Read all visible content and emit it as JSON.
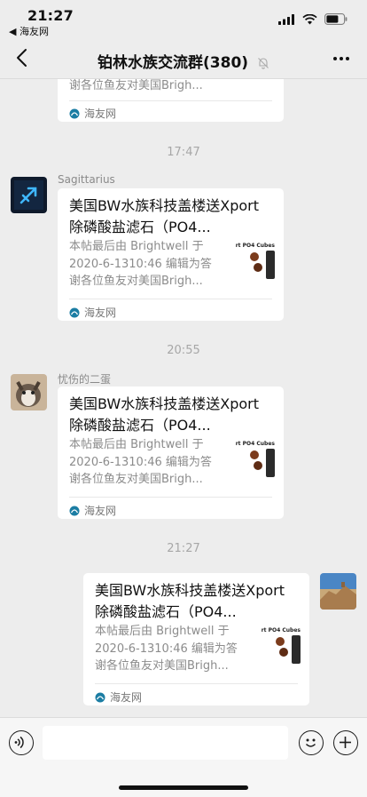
{
  "status": {
    "time": "21:27",
    "back_app": "◀ 海友网"
  },
  "nav": {
    "title": "铂林水族交流群(380)"
  },
  "messages": {
    "m0": {
      "desc_tail": "谢各位鱼友对美国Brigh...",
      "source": "海友网"
    },
    "ts1": "17:47",
    "m1": {
      "sender": "Sagittarius",
      "title": "美国BW水族科技盖楼送Xport除磷酸盐滤石（PO4...",
      "desc": "本帖最后由 Brightwell 于 2020-6-1310:46 编辑为答谢各位鱼友对美国Brigh...",
      "source": "海友网",
      "thumb_label": "rt PO4 Cubes"
    },
    "ts2": "20:55",
    "m2": {
      "sender": "忧伤的二蛋",
      "title": "美国BW水族科技盖楼送Xport除磷酸盐滤石（PO4...",
      "desc": "本帖最后由 Brightwell 于 2020-6-1310:46 编辑为答谢各位鱼友对美国Brigh...",
      "source": "海友网",
      "thumb_label": "rt PO4 Cubes"
    },
    "ts3": "21:27",
    "m3": {
      "title": "美国BW水族科技盖楼送Xport除磷酸盐滤石（PO4...",
      "desc": "本帖最后由 Brightwell 于 2020-6-1310:46 编辑为答谢各位鱼友对美国Brigh...",
      "source": "海友网",
      "thumb_label": "rt PO4 Cubes"
    }
  },
  "icons": {
    "back": "chevron-left-icon",
    "mute": "bell-off-icon",
    "more": "more-icon",
    "voice": "voice-icon",
    "emoji": "emoji-icon",
    "plus": "plus-icon",
    "signal": "signal-icon",
    "wifi": "wifi-icon",
    "battery": "battery-icon"
  }
}
